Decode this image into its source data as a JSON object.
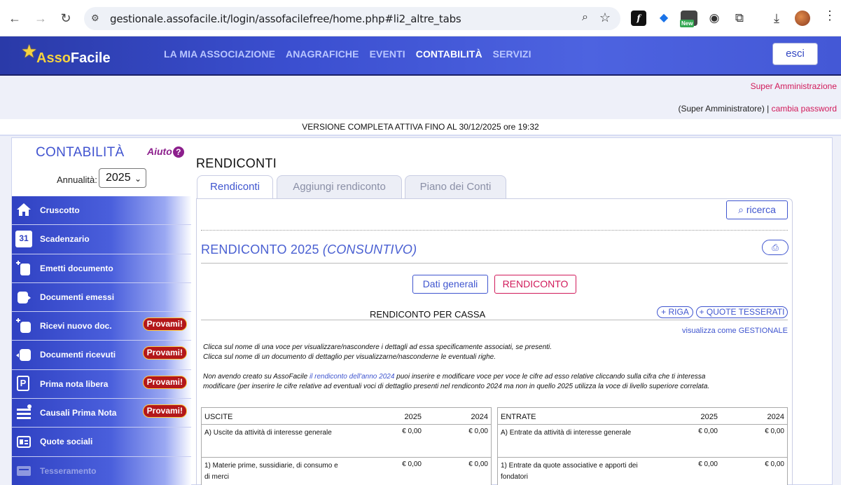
{
  "browser": {
    "url": "gestionale.assofacile.it/login/assofacilefree/home.php#li2_altre_tabs",
    "ext_new_badge": "New"
  },
  "app": {
    "logo_a": "Asso",
    "logo_b": "Facile",
    "menu": [
      "LA MIA ASSOCIAZIONE",
      "ANAGRAFICHE",
      "EVENTI",
      "CONTABILITÀ",
      "SERVIZI"
    ],
    "exit_label": "esci",
    "super_admin_link": "Super Amministrazione",
    "user_role": "(Super Amministratore) |",
    "change_password": "cambia password",
    "version_notice": "VERSIONE COMPLETA ATTIVA FINO AL 30/12/2025 ore 19:32"
  },
  "sidebar": {
    "title": "CONTABILITÀ",
    "help": "Aiuto",
    "year_label": "Annualità:",
    "year_value": "2025",
    "promo_label": "Provami!",
    "items": [
      {
        "label": "Cruscotto",
        "icon": "home-icon"
      },
      {
        "label": "Scadenzario",
        "icon": "calendar-icon",
        "icon_text": "31"
      },
      {
        "label": "Emetti documento",
        "icon": "new-document-icon"
      },
      {
        "label": "Documenti emessi",
        "icon": "issued-documents-icon"
      },
      {
        "label": "Ricevi nuovo doc.",
        "icon": "receive-document-icon",
        "promo": true
      },
      {
        "label": "Documenti ricevuti",
        "icon": "received-documents-icon",
        "promo": true
      },
      {
        "label": "Prima nota libera",
        "icon": "journal-icon",
        "icon_text": "P",
        "promo": true
      },
      {
        "label": "Causali Prima Nota",
        "icon": "list-icon",
        "promo": true
      },
      {
        "label": "Quote sociali",
        "icon": "membership-fees-icon"
      },
      {
        "label": "Tesseramento",
        "icon": "membership-card-icon"
      }
    ]
  },
  "main": {
    "page_title": "RENDICONTI",
    "tabs": [
      "Rendiconti",
      "Aggiungi rendiconto",
      "Piano dei Conti"
    ],
    "search_label": "ricerca",
    "report_title": "RENDICONTO 2025",
    "report_subtitle": "(CONSUNTIVO)",
    "btn_general": "Dati generali",
    "btn_report": "RENDICONTO",
    "cash_title": "RENDICONTO PER CASSA",
    "btn_add_row": "+ RIGA",
    "btn_add_fees": "+ QUOTE TESSERATI",
    "view_as_link": "visualizza come GESTIONALE",
    "note_line1": "Clicca sul nome di una voce per visualizzare/nascondere i dettagli ad essa specificamente associati, se presenti.",
    "note_line2": "Clicca sul nome di un documento di dettaglio per visualizzarne/nasconderne le eventuali righe.",
    "note_p3_a": "Non avendo creato su AssoFacile ",
    "note_p3_link": "il rendiconto dell'anno 2024",
    "note_p3_b": " puoi inserire e modificare voce per voce le cifre ad esso relative cliccando sulla cifra che ti interessa",
    "note_p3_c": "modificare (per inserire le cifre relative ad eventuali voci di dettaglio presenti nel rendiconto 2024 ma non in quello 2025 utilizza la voce di livello superiore correlata."
  },
  "ledger": {
    "out": {
      "heading": "USCITE",
      "years": [
        "2025",
        "2024"
      ],
      "rows": [
        {
          "label": "A) Uscite da attività di interesse generale",
          "v2025": "€ 0,00",
          "v2024": "€ 0,00"
        },
        {
          "label": "1) Materie prime, sussidiarie, di consumo e di merci",
          "v2025": "€ 0,00",
          "v2024": "€ 0,00"
        }
      ]
    },
    "in": {
      "heading": "ENTRATE",
      "years": [
        "2025",
        "2024"
      ],
      "rows": [
        {
          "label": "A) Entrate da attività di interesse generale",
          "v2025": "€ 0,00",
          "v2024": "€ 0,00"
        },
        {
          "label": "1) Entrate da quote associative e apporti dei fondatori",
          "v2025": "€ 0,00",
          "v2024": "€ 0,00"
        }
      ]
    }
  },
  "colors": {
    "accent_blue": "#3f55cf",
    "link_red": "#d11a5a",
    "promo_badge": "#b3171a"
  }
}
